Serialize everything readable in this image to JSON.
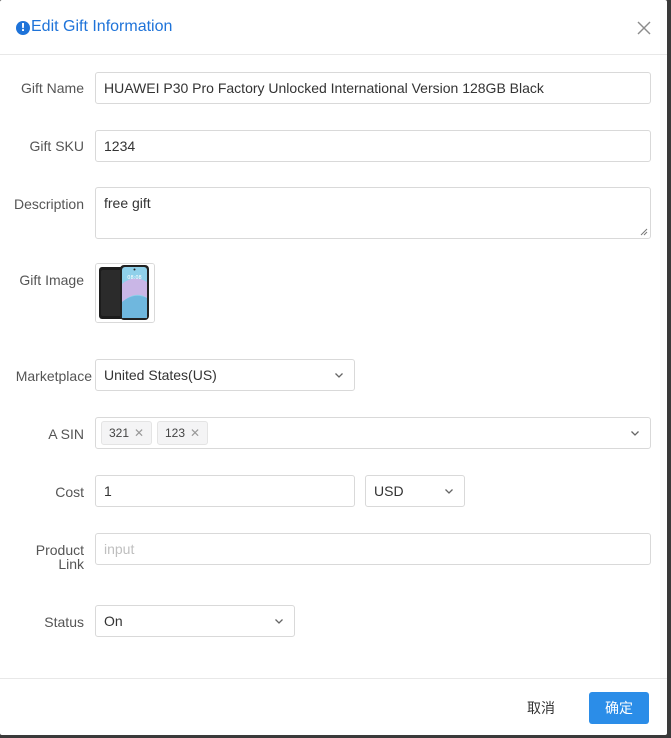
{
  "dialog": {
    "title": "Edit Gift Information",
    "title_icon": "info-icon",
    "close_icon": "close-icon"
  },
  "form": {
    "gift_name": {
      "label": "Gift Name",
      "value": "HUAWEI P30 Pro Factory Unlocked International Version 128GB Black"
    },
    "gift_sku": {
      "label": "Gift SKU",
      "value": "1234"
    },
    "description": {
      "label": "Description",
      "value": "free gift"
    },
    "gift_image": {
      "label": "Gift Image"
    },
    "marketplace": {
      "label": "Marketplace",
      "value": "United States(US)"
    },
    "asin": {
      "label": "A SIN",
      "tags": [
        "321",
        "123"
      ]
    },
    "cost": {
      "label": "Cost",
      "value": "1",
      "currency": "USD"
    },
    "product_link": {
      "label_line1": "Product",
      "label_line2": "Link",
      "placeholder": "input",
      "value": ""
    },
    "status": {
      "label": "Status",
      "value": "On"
    }
  },
  "footer": {
    "cancel_label": "取消",
    "ok_label": "确定"
  },
  "colors": {
    "accent": "#1e73d9",
    "primary_button": "#2b8de8",
    "border": "#d9d9d9"
  }
}
